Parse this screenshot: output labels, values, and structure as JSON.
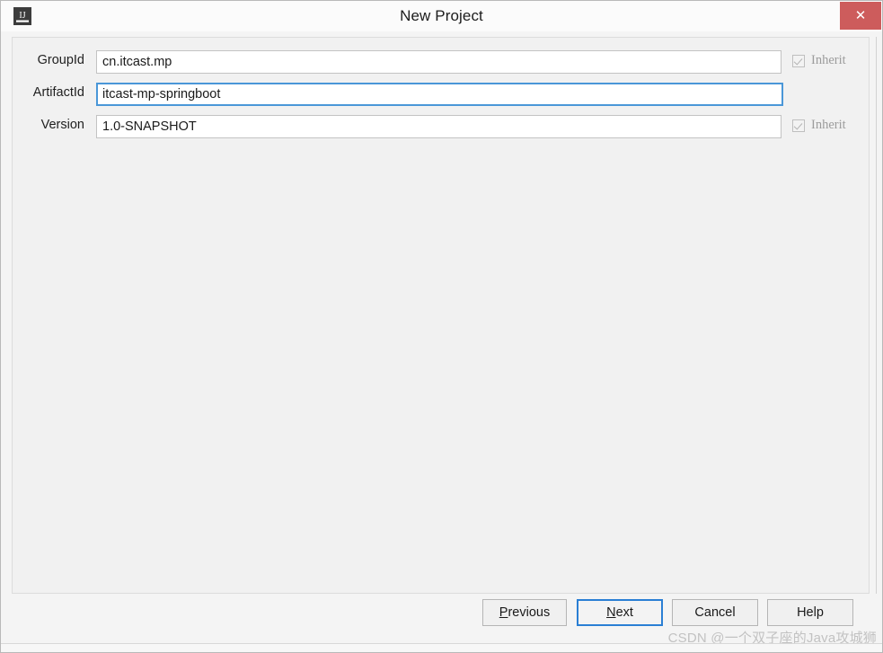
{
  "window": {
    "app_icon": "intellij-idea-icon",
    "title": "New Project",
    "close_label": "✕"
  },
  "form": {
    "fields": [
      {
        "label": "GroupId",
        "value": "cn.itcast.mp",
        "focused": false,
        "inherit_label": "Inherit",
        "inherit_checked": true,
        "inherit_enabled": false
      },
      {
        "label": "ArtifactId",
        "value": "itcast-mp-springboot",
        "focused": true,
        "inherit_label": "",
        "inherit_checked": false,
        "inherit_enabled": false
      },
      {
        "label": "Version",
        "value": "1.0-SNAPSHOT",
        "focused": false,
        "inherit_label": "Inherit",
        "inherit_checked": true,
        "inherit_enabled": false
      }
    ]
  },
  "buttons": {
    "previous": {
      "prefix": "",
      "mnemonic": "P",
      "suffix": "revious"
    },
    "next": {
      "prefix": "",
      "mnemonic": "N",
      "suffix": "ext"
    },
    "cancel": {
      "label": "Cancel"
    },
    "help": {
      "label": "Help"
    }
  },
  "watermark": {
    "text": "CSDN @一个双子座的Java攻城狮"
  },
  "colors": {
    "close_button": "#cd5c5c",
    "focus_border": "#4a97d8",
    "dialog_background": "#f4f4f4",
    "panel_background": "#f1f1f1",
    "titlebar_background": "#fbfbfb"
  }
}
